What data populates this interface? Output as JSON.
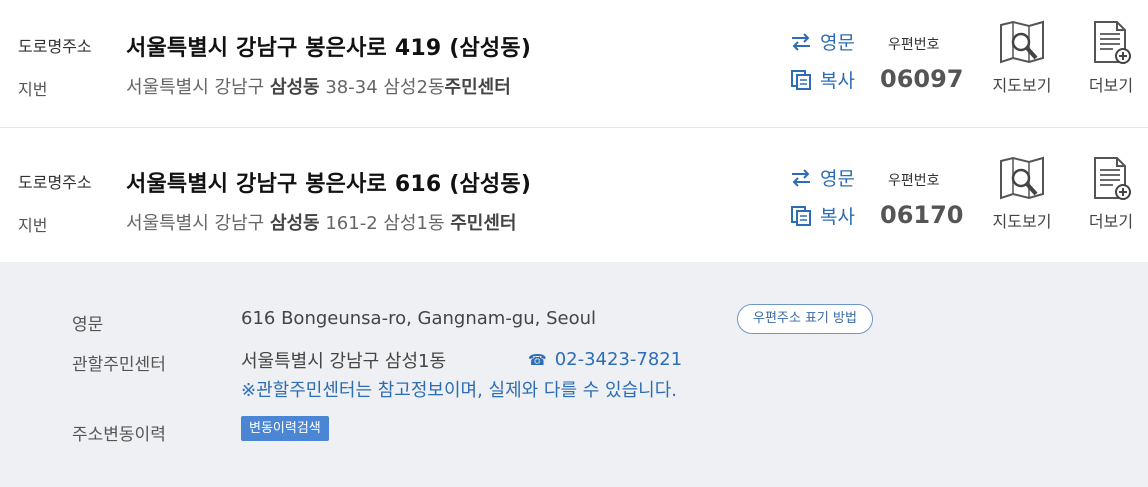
{
  "results": [
    {
      "road_label": "도로명주소",
      "road_address": "서울특별시 강남구 봉은사로 419 (삼성동)",
      "jibun_label": "지번",
      "jibun_prefix": "서울특별시 강남구 ",
      "jibun_dong": "삼성동",
      "jibun_mid": " 38-34 삼성2동",
      "jibun_center": "주민센터",
      "english_label": "영문",
      "copy_label": "복사",
      "zip_label": "우편번호",
      "zip_code": "06097",
      "map_label": "지도보기",
      "more_label": "더보기"
    },
    {
      "road_label": "도로명주소",
      "road_address": "서울특별시 강남구 봉은사로 616 (삼성동)",
      "jibun_label": "지번",
      "jibun_prefix": "서울특별시 강남구 ",
      "jibun_dong": "삼성동",
      "jibun_mid": " 161-2 삼성1동 ",
      "jibun_center": "주민센터",
      "english_label": "영문",
      "copy_label": "복사",
      "zip_label": "우편번호",
      "zip_code": "06170",
      "map_label": "지도보기",
      "more_label": "더보기"
    }
  ],
  "detail": {
    "english_label": "영문",
    "english_value": "616 Bongeunsa-ro, Gangnam-gu, Seoul",
    "notation_button": "우편주소 표기 방법",
    "center_label": "관할주민센터",
    "center_value": "서울특별시 강남구 삼성1동",
    "center_phone": "02-3423-7821",
    "center_note": "※관할주민센터는 참고정보이며, 실제와 다를 수 있습니다.",
    "history_label": "주소변동이력",
    "history_button": "변동이력검색"
  },
  "colors": {
    "accent": "#2d6db5",
    "detail_bg": "#eef0f3",
    "history_button_bg": "#4a86d4"
  }
}
